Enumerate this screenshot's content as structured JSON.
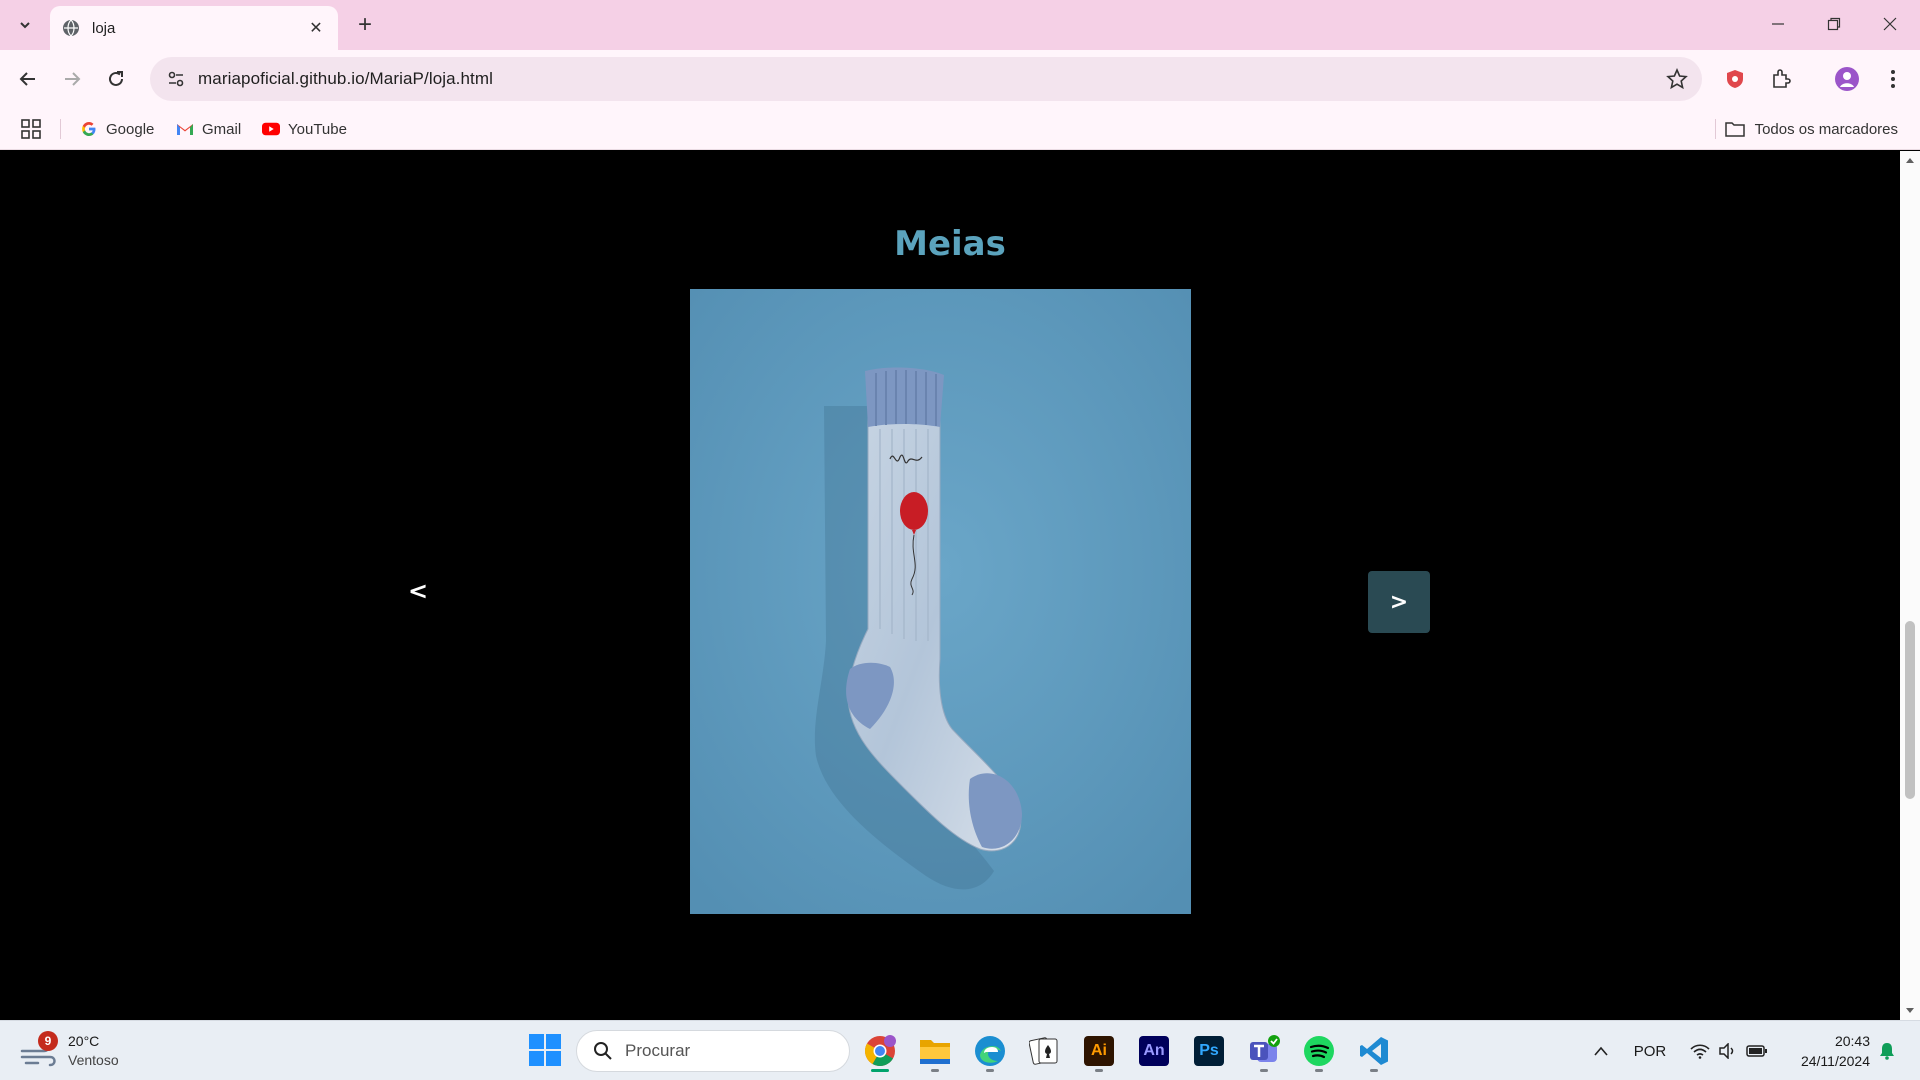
{
  "browser": {
    "tab_title": "loja",
    "url": "mariapoficial.github.io/MariaP/loja.html",
    "bookmarks": [
      {
        "label": "Google",
        "icon": "google-icon"
      },
      {
        "label": "Gmail",
        "icon": "gmail-icon"
      },
      {
        "label": "YouTube",
        "icon": "youtube-icon"
      }
    ],
    "all_bookmarks_label": "Todos os marcadores",
    "accent_color": "#f5d0e6"
  },
  "page": {
    "heading": "Meias",
    "prev_label": "<",
    "next_label": ">",
    "product_image": "sock-product-photo",
    "heading_color": "#5ba3bd"
  },
  "taskbar": {
    "weather_temp": "20°C",
    "weather_desc": "Ventoso",
    "weather_badge": "9",
    "search_placeholder": "Procurar",
    "apps": [
      "chrome-icon",
      "file-explorer-icon",
      "edge-icon",
      "solitaire-icon",
      "illustrator-icon",
      "animate-icon",
      "photoshop-icon",
      "teams-icon",
      "spotify-icon",
      "vscode-icon"
    ],
    "illustrator_label": "Ai",
    "animate_label": "An",
    "photoshop_label": "Ps",
    "language": "POR",
    "time": "20:43",
    "date": "24/11/2024"
  }
}
